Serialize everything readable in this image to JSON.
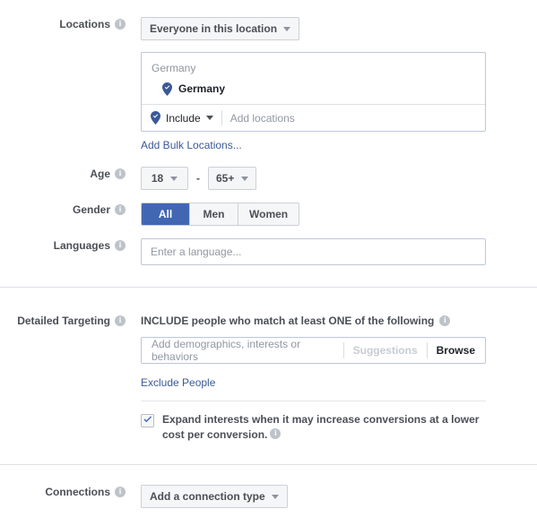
{
  "locations": {
    "label": "Locations",
    "info_icon": "info-icon",
    "audience_type_button": "Everyone in this location",
    "box": {
      "group_heading": "Germany",
      "items": [
        {
          "name": "Germany",
          "icon": "map-pin-icon"
        }
      ],
      "include_dropdown": "Include",
      "add_locations_placeholder": "Add locations"
    },
    "bulk_link": "Add Bulk Locations..."
  },
  "age": {
    "label": "Age",
    "min": "18",
    "max": "65+",
    "separator": "-"
  },
  "gender": {
    "label": "Gender",
    "options": [
      {
        "label": "All",
        "selected": true
      },
      {
        "label": "Men",
        "selected": false
      },
      {
        "label": "Women",
        "selected": false
      }
    ]
  },
  "languages": {
    "label": "Languages",
    "placeholder": "Enter a language...",
    "value": ""
  },
  "detailed_targeting": {
    "label": "Detailed Targeting",
    "headline": "INCLUDE people who match at least ONE of the following",
    "input_placeholder": "Add demographics, interests or behaviors",
    "suggestions_label": "Suggestions",
    "browse_label": "Browse",
    "exclude_link": "Exclude People",
    "expand_checkbox": {
      "checked": true,
      "text": "Expand interests when it may increase conversions at a lower cost per conversion."
    }
  },
  "connections": {
    "label": "Connections",
    "button": "Add a connection type"
  },
  "colors": {
    "accent_blue": "#4267b2",
    "link_blue": "#3b5998",
    "label_gray": "#4b4f56",
    "placeholder_gray": "#9197a3",
    "border_gray": "#ccd0d5",
    "input_border": "#bdc7d8",
    "divider": "#dfe0e4"
  }
}
